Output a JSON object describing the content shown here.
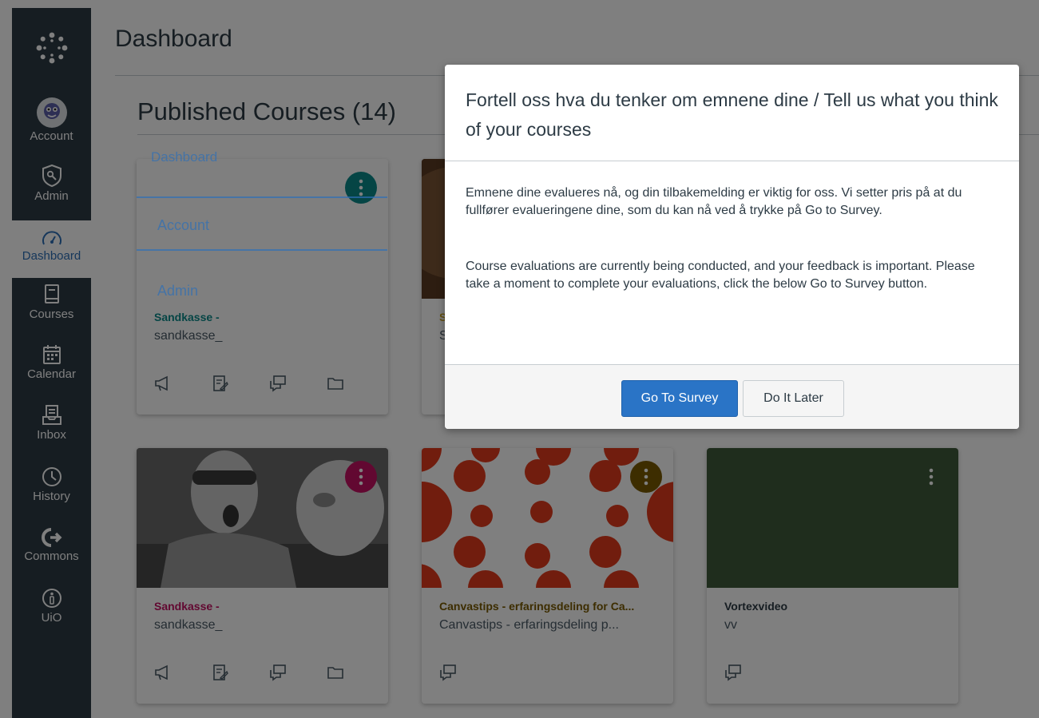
{
  "nav": {
    "items": [
      {
        "label": "Account",
        "icon": "avatar-icon"
      },
      {
        "label": "Admin",
        "icon": "shield-icon"
      },
      {
        "label": "Dashboard",
        "icon": "dashboard-icon",
        "active": true
      },
      {
        "label": "Courses",
        "icon": "book-icon"
      },
      {
        "label": "Calendar",
        "icon": "calendar-icon"
      },
      {
        "label": "Inbox",
        "icon": "inbox-icon"
      },
      {
        "label": "History",
        "icon": "clock-icon"
      },
      {
        "label": "Commons",
        "icon": "commons-icon"
      },
      {
        "label": "UiO",
        "icon": "info-icon"
      }
    ]
  },
  "page": {
    "title": "Dashboard",
    "section_title": "Published Courses (14)"
  },
  "tour": {
    "items": [
      "Dashboard",
      "Account",
      "Admin"
    ]
  },
  "cards": [
    {
      "title": "Sandkasse -",
      "subtitle": "sandkasse_",
      "color": "#0b8a8a"
    },
    {
      "title": "S",
      "subtitle": "S",
      "color": "#c9a227"
    },
    {
      "title": "Sandkasse -",
      "subtitle": "sandkasse_",
      "color": "#c51162"
    },
    {
      "title": "Canvastips - erfaringsdeling for Ca...",
      "subtitle": "Canvastips - erfaringsdeling p...",
      "color": "#7a5a00"
    },
    {
      "title": "Vortexvideo",
      "subtitle": "vv",
      "color": "#2d3b45"
    }
  ],
  "modal": {
    "title": "Fortell oss hva du tenker om emnene dine / Tell us what you think of your courses",
    "body_no": "Emnene dine evalueres nå, og din tilbakemelding er viktig for oss. Vi setter pris på at du fullfører evalueringene dine, som du kan nå ved å trykke på Go to Survey.",
    "body_en": "Course evaluations are currently being conducted, and your feedback is important. Please take a moment to complete your evaluations, click the below Go to Survey button.",
    "primary_button": "Go To Survey",
    "secondary_button": "Do It Later"
  },
  "colors": {
    "nav_bg": "#2d3b45",
    "accent": "#2d6fb7",
    "primary_button": "#2a74c6"
  }
}
